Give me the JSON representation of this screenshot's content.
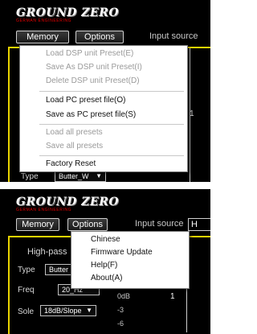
{
  "logo": {
    "title": "GROUND ZERO",
    "subtitle": "GERMAN ENGINEERING"
  },
  "toolbar": {
    "memory_label": "Memory",
    "options_label": "Options",
    "input_source_label": "Input source"
  },
  "memory_menu": {
    "items": [
      {
        "label": "Load DSP unit Preset(E)",
        "enabled": false
      },
      {
        "label": "Save As DSP unit Preset(I)",
        "enabled": false
      },
      {
        "label": "Delete DSP unit Preset(D)",
        "enabled": false
      },
      {
        "label": "Load PC preset file(O)",
        "enabled": true
      },
      {
        "label": "Save as PC preset file(S)",
        "enabled": true
      },
      {
        "label": "Load all presets",
        "enabled": false
      },
      {
        "label": "Save all presets",
        "enabled": false
      },
      {
        "label": "Factory Reset",
        "enabled": true
      }
    ]
  },
  "options_menu": {
    "items": [
      {
        "label": "Chinese"
      },
      {
        "label": "Firmware Update"
      },
      {
        "label": "Help(F)"
      },
      {
        "label": "About(A)"
      }
    ]
  },
  "filter_panel": {
    "title": "High-pass",
    "type_label": "Type",
    "type_value": "Butter_W",
    "type_value_short": "Butter",
    "freq_label": "Freq",
    "freq_value": "20_Hz",
    "slope_label": "Sole",
    "slope_value": "18dB/Slope"
  },
  "graph": {
    "y_labels": [
      "0dB",
      "-3",
      "-6"
    ],
    "marker_top": "1",
    "marker_bottom": "1"
  },
  "input_source_value": "H",
  "colors": {
    "frame": "#e8d400",
    "brand_red": "#e00000",
    "background": "#000000"
  }
}
